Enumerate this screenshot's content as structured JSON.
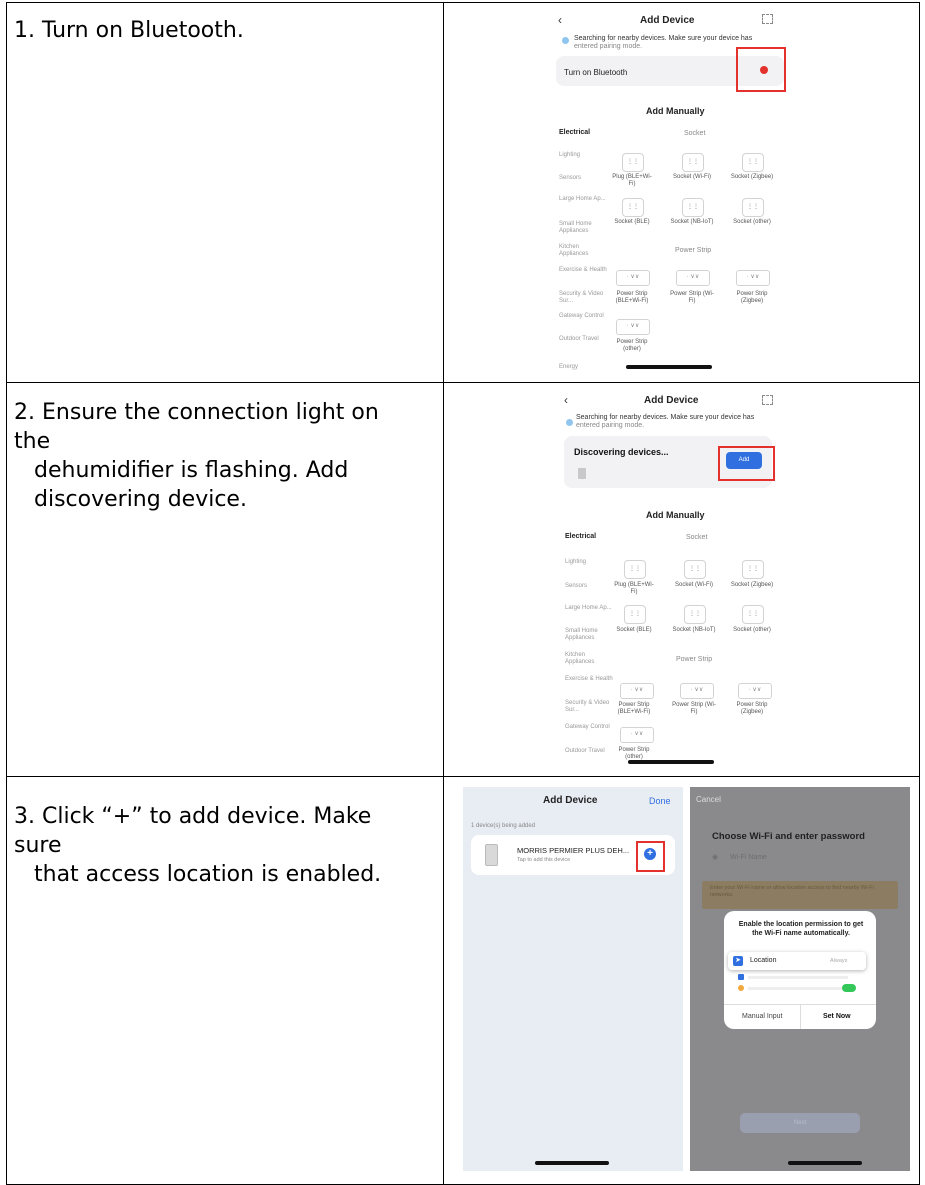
{
  "steps": [
    {
      "line1": "1. Turn on Bluetooth."
    },
    {
      "line1": "2.  Ensure the connection light on the",
      "line2": "dehumidifier is flashing. Add",
      "line3": "discovering device."
    },
    {
      "line1": "3. Click “+”  to add device. Make sure",
      "line2": "that access location is enabled."
    }
  ],
  "screen1": {
    "back_icon": "chevron-left-icon",
    "title": "Add Device",
    "scan_icon": "scan-icon",
    "search_msg": "Searching for nearby devices. Make sure your device has",
    "search_msg2": "entered pairing mode.",
    "bt_label": "Turn on Bluetooth",
    "add_manually": "Add Manually",
    "category_active": "Electrical",
    "group_socket": "Socket",
    "group_strip": "Power Strip",
    "categories": [
      "Lighting",
      "Sensors",
      "Large Home Ap...",
      "Small Home Appliances",
      "Kitchen Appliances",
      "Exercise & Health",
      "Security & Video Sur...",
      "Gateway Control",
      "Outdoor Travel",
      "Energy"
    ],
    "devices": [
      "Plug (BLE+Wi-Fi)",
      "Socket (Wi-Fi)",
      "Socket (Zigbee)",
      "Socket (BLE)",
      "Socket (NB-IoT)",
      "Socket (other)"
    ],
    "strips": [
      "Power Strip (BLE+Wi-Fi)",
      "Power Strip (Wi-Fi)",
      "Power Strip (Zigbee)",
      "Power Strip (other)"
    ]
  },
  "screen2": {
    "back_icon": "chevron-left-icon",
    "title": "Add Device",
    "search_msg": "Searching for nearby devices. Make sure your device has",
    "search_msg2": "entered pairing mode.",
    "discovering": "Discovering devices...",
    "add_button": "Add",
    "add_manually": "Add Manually",
    "category_active": "Electrical",
    "group_socket": "Socket",
    "group_strip": "Power Strip",
    "categories": [
      "Lighting",
      "Sensors",
      "Large Home Ap...",
      "Small Home Appliances",
      "Kitchen Appliances",
      "Exercise & Health",
      "Security & Video Sur...",
      "Gateway Control",
      "Outdoor Travel"
    ],
    "devices": [
      "Plug (BLE+Wi-Fi)",
      "Socket (Wi-Fi)",
      "Socket (Zigbee)",
      "Socket (BLE)",
      "Socket (NB-IoT)",
      "Socket (other)"
    ],
    "strips": [
      "Power Strip (BLE+Wi-Fi)",
      "Power Strip (Wi-Fi)",
      "Power Strip (Zigbee)",
      "Power Strip (other)"
    ]
  },
  "screen3": {
    "title": "Add Device",
    "done": "Done",
    "count": "1 device(s) being added",
    "device_name": "MORRIS PERMIER PLUS DEH...",
    "device_sub": "Tap to add this device"
  },
  "screen4": {
    "cancel": "Cancel",
    "title": "Choose Wi-Fi and enter password",
    "wifi_placeholder": "Wi-Fi Name",
    "warning": "Enter your Wi-Fi name or allow location access to find nearby Wi-Fi networks.",
    "dialog_msg": "Enable the location permission to get the Wi-Fi name automatically.",
    "location_label": "Location",
    "location_value": "Always",
    "manual": "Manual Input",
    "set_now": "Set Now",
    "next": "Next"
  },
  "colors": {
    "accent_red": "#e3322d",
    "blue": "#2f6fe0",
    "green": "#34c759"
  }
}
